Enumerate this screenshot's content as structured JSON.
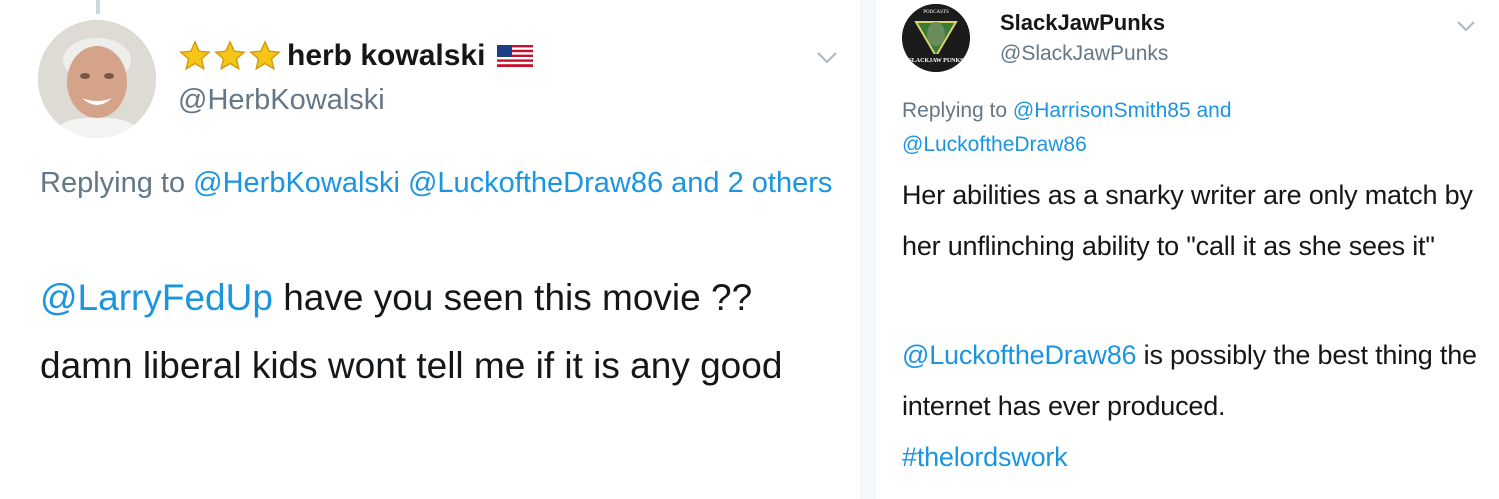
{
  "left_tweet": {
    "display_name": "herb kowalski",
    "handle": "@HerbKowalski",
    "icons": [
      "star-icon",
      "star-icon",
      "star-icon",
      "us-flag-icon",
      "chevron-down-icon"
    ],
    "reply_prefix": "Replying to",
    "reply_mention_1": "@HerbKowalski",
    "reply_mention_2": "@LuckoftheDraw86",
    "reply_suffix": "and 2 others",
    "text_mention": "@LarryFedUp",
    "text_body": "have you seen this movie ?? damn liberal kids wont tell me if it is any good"
  },
  "right_tweet": {
    "display_name": "SlackJawPunks",
    "handle": "@SlackJawPunks",
    "avatar_logo_text_top": "PODCASTS",
    "avatar_logo_text_bottom": "SLACKJAW PUNKS",
    "reply_prefix": "Replying to",
    "reply_mention_1": "@HarrisonSmith85",
    "reply_and": "and",
    "reply_mention_2": "@LuckoftheDraw86",
    "text_line1": "Her abilities as a snarky writer are only match by her unflinching ability to \"call it as she sees it\"",
    "text_mention": "@LuckoftheDraw86",
    "text_body": "is possibly the best thing the internet has ever produced.",
    "hashtag": "#thelordswork"
  },
  "colors": {
    "link": "#1b95e0",
    "secondary_text": "#657786",
    "primary_text": "#14171a",
    "star": "#f5c518",
    "seam": "#f5f8fa"
  }
}
